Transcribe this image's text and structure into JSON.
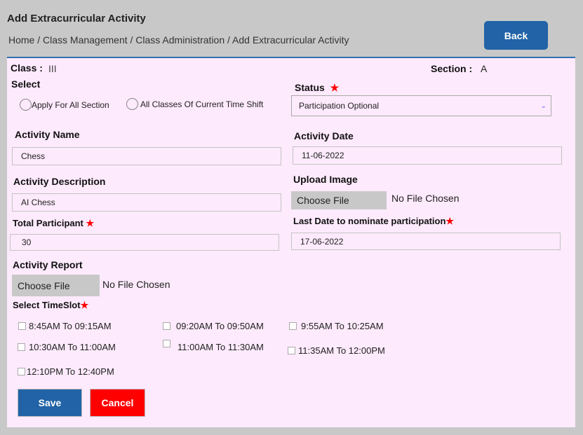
{
  "header": {
    "title": "Add Extracurricular Activity",
    "breadcrumb": "Home / Class Management / Class Administration / Add Extracurricular Activity",
    "back_label": "Back"
  },
  "form": {
    "class_label": "Class :",
    "class_value": "III",
    "section_label": "Section :",
    "section_value": "A",
    "select_label": "Select",
    "radio1": "Apply For All Section",
    "radio2": "All Classes Of Current Time Shift",
    "status_label": "Status",
    "status_value": "Participation Optional",
    "activity_name_label": "Activity Name",
    "activity_name_value": "Chess",
    "activity_date_label": "Activity Date",
    "activity_date_value": "11-06-2022",
    "activity_desc_label": "Activity Description",
    "activity_desc_value": "AI Chess",
    "upload_image_label": "Upload Image",
    "choose_file": "Choose File",
    "no_file": "No File Chosen",
    "total_participant_label": "Total Participant",
    "total_participant_value": "30",
    "last_date_label": "Last Date to nominate participation",
    "last_date_value": "17-06-2022",
    "activity_report_label": "Activity Report",
    "timeslot_label": "Select TimeSlot",
    "timeslots": [
      "8:45AM To 09:15AM",
      "09:20AM To 09:50AM",
      "9:55AM To 10:25AM",
      "10:30AM To 11:00AM",
      "11:00AM To 11:30AM",
      "11:35AM To 12:00PM",
      "12:10PM To 12:40PM"
    ],
    "star": "★",
    "save_label": "Save",
    "cancel_label": "Cancel"
  },
  "colors": {
    "primary": "#2163a6",
    "danger": "#ff0000",
    "panel": "#fdeafc"
  }
}
